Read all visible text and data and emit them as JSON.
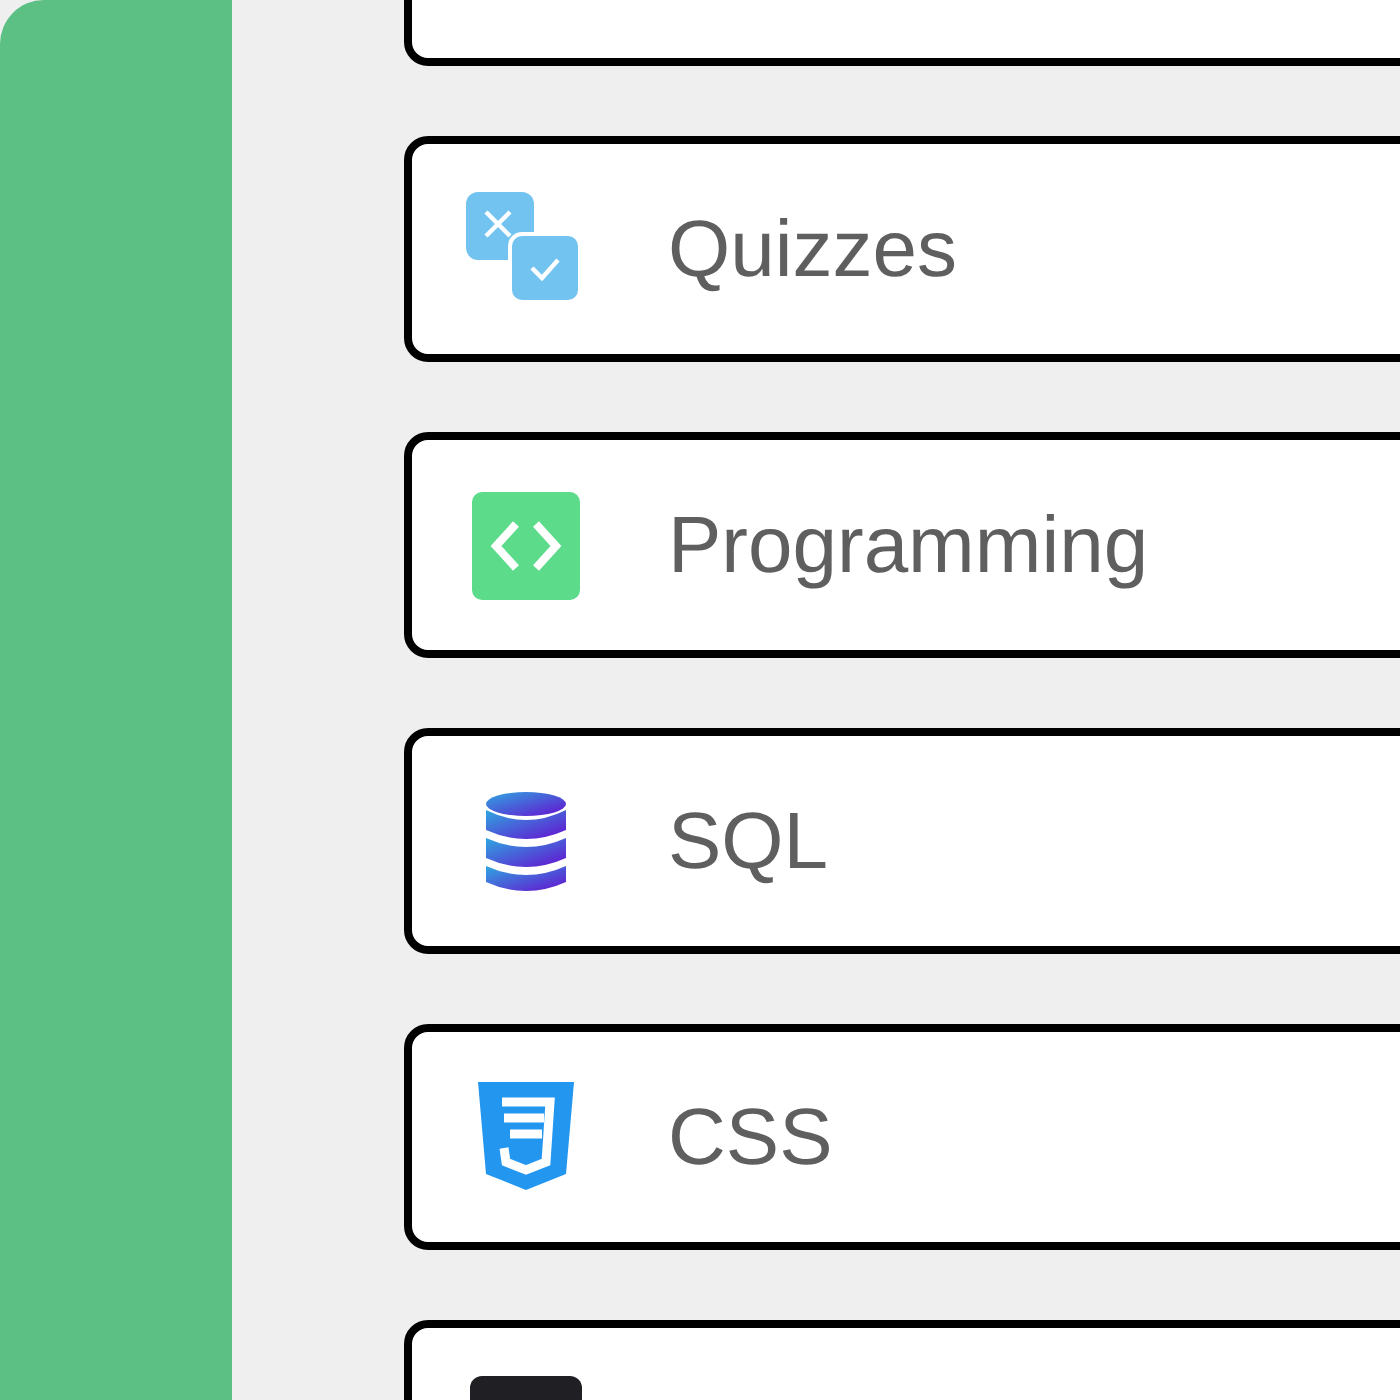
{
  "items": [
    {
      "kind": "blank"
    },
    {
      "kind": "quiz",
      "label": "Quizzes"
    },
    {
      "kind": "code",
      "label": "Programming"
    },
    {
      "kind": "database",
      "label": "SQL"
    },
    {
      "kind": "css",
      "label": "CSS"
    },
    {
      "kind": "dark"
    }
  ]
}
